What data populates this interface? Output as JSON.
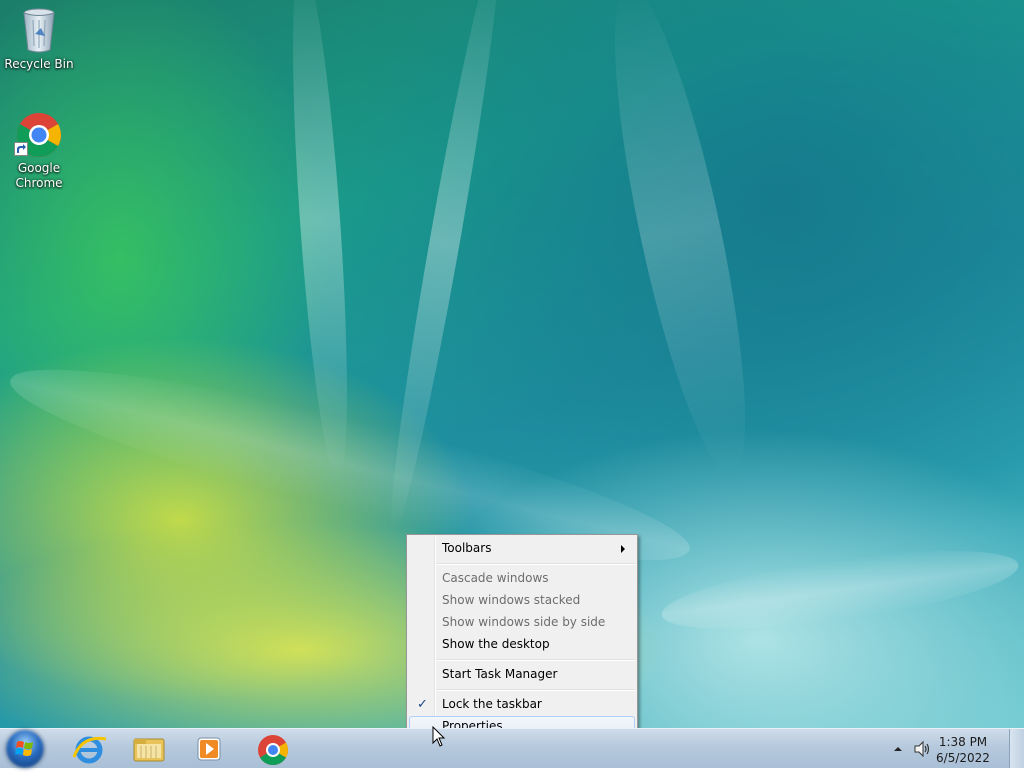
{
  "desktop": {
    "icons": [
      {
        "label": "Recycle Bin",
        "icon": "recycle-bin-icon"
      },
      {
        "label_line1": "Google",
        "label_line2": "Chrome",
        "icon": "chrome-icon"
      }
    ]
  },
  "context_menu": {
    "items": [
      {
        "label": "Toolbars",
        "state": "enabled",
        "submenu": true
      },
      {
        "label": "Cascade windows",
        "state": "disabled"
      },
      {
        "label": "Show windows stacked",
        "state": "disabled"
      },
      {
        "label": "Show windows side by side",
        "state": "disabled"
      },
      {
        "label": "Show the desktop",
        "state": "enabled"
      },
      {
        "label": "Start Task Manager",
        "state": "enabled"
      },
      {
        "label": "Lock the taskbar",
        "state": "enabled",
        "checked": true
      },
      {
        "label": "Properties",
        "state": "highlighted"
      }
    ],
    "check_glyph": "✓"
  },
  "taskbar": {
    "pinned": [
      "internet-explorer-icon",
      "file-explorer-icon",
      "media-player-icon",
      "chrome-icon"
    ],
    "tray": {
      "time": "1:38 PM",
      "date": "6/5/2022",
      "icons": [
        "show-hidden-icons-arrow",
        "volume-icon"
      ]
    }
  },
  "colors": {
    "taskbar_top": "#cfdcea",
    "menu_bg": "#f0f0f0",
    "menu_disabled_text": "#6d6d6d",
    "highlight_border": "#aecff7"
  }
}
